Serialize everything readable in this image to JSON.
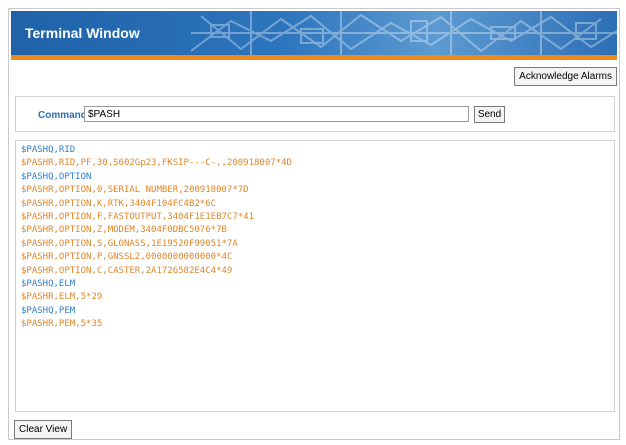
{
  "header": {
    "title": "Terminal Window"
  },
  "toolbar": {
    "acknowledge_label": "Acknowledge Alarms"
  },
  "command": {
    "label": "Command",
    "value": "$PASH",
    "send_label": "Send"
  },
  "terminal": {
    "lines": [
      {
        "text": "$PASHQ,RID",
        "type": "query"
      },
      {
        "text": "$PASHR,RID,PF,30,S602Gp23,FKSIP---C-,,200918007*4D",
        "type": "response"
      },
      {
        "text": "$PASHQ,OPTION",
        "type": "query"
      },
      {
        "text": "$PASHR,OPTION,0,SERIAL NUMBER,200918007*7D",
        "type": "response"
      },
      {
        "text": "$PASHR,OPTION,K,RTK,3404F104FC4B2*6C",
        "type": "response"
      },
      {
        "text": "$PASHR,OPTION,F,FASTOUTPUT,3404F1E1EB7C7*41",
        "type": "response"
      },
      {
        "text": "$PASHR,OPTION,Z,MODEM,3404F0DBC5076*7B",
        "type": "response"
      },
      {
        "text": "$PASHR,OPTION,S,GLONASS,1E19520F99051*7A",
        "type": "response"
      },
      {
        "text": "$PASHR,OPTION,P,GNSSL2,0000000000000*4C",
        "type": "response"
      },
      {
        "text": "$PASHR,OPTION,C,CASTER,2A1726582E4C4*49",
        "type": "response"
      },
      {
        "text": "$PASHQ,ELM",
        "type": "query"
      },
      {
        "text": "$PASHR,ELM,5*29",
        "type": "response"
      },
      {
        "text": "$PASHQ,PEM",
        "type": "query"
      },
      {
        "text": "$PASHR,PEM,5*35",
        "type": "response"
      }
    ]
  },
  "footer": {
    "clear_label": "Clear View"
  },
  "colors": {
    "query": "#2e7fd0",
    "response": "#e0862a",
    "accent": "#f08a1c",
    "header": "#2d75bd"
  }
}
